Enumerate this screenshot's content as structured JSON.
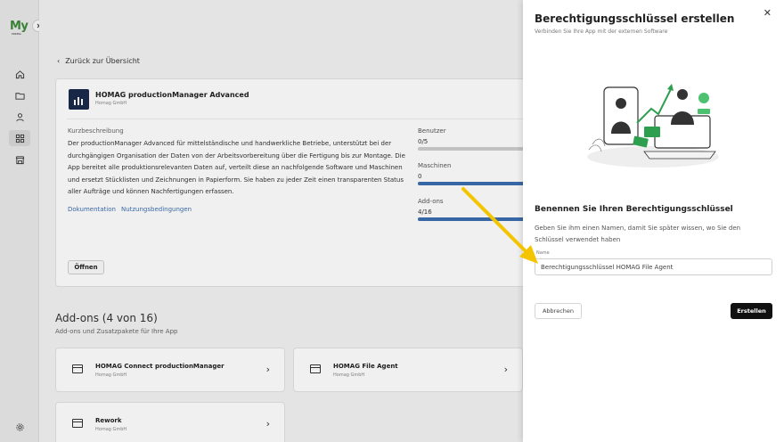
{
  "rail": {
    "logo": "My",
    "logo_sub": "HOMAG"
  },
  "main": {
    "back_link": "Zurück zur Übersicht",
    "app": {
      "title": "HOMAG productionManager Advanced",
      "vendor": "Homag GmbH",
      "description_label": "Kurzbeschreibung",
      "description": "Der productionManager Advanced für mittelständische und handwerkliche Betriebe, unterstützt bei der durchgängigen Organisation der Daten von der Arbeitsvorbereitung über die Fertigung bis zur Montage. Die App bereitet alle produktionsrelevanten Daten auf, verteilt diese an nachfolgende Software und Maschinen und ersetzt Stücklisten und Zeichnungen in Papierform. Sie haben zu jeder Zeit einen transparenten Status aller Aufträge und können Nachfertigungen erfassen.",
      "link_docs": "Dokumentation",
      "link_terms": "Nutzungsbedingungen",
      "open_button": "Öffnen",
      "stats": [
        {
          "label": "Benutzer",
          "value": "0/5",
          "fill": 0
        },
        {
          "label": "Maschinen",
          "value": "0",
          "fill": 1
        },
        {
          "label": "Add-ons",
          "value": "4/16",
          "fill": 1
        }
      ]
    },
    "addons": {
      "title": "Add-ons (4 von 16)",
      "subtitle": "Add-ons und Zusatzpakete für Ihre App",
      "items": [
        {
          "title": "HOMAG Connect productionManager",
          "vendor": "Homag GmbH"
        },
        {
          "title": "HOMAG File Agent",
          "vendor": "Homag GmbH"
        },
        {
          "title": "Rework",
          "vendor": "Homag GmbH"
        }
      ]
    }
  },
  "drawer": {
    "title": "Berechtigungsschlüssel erstellen",
    "subtitle": "Verbinden Sie Ihre App mit der externen Software",
    "heading": "Benennen Sie Ihren Berechtigungsschlüssel",
    "text": "Geben Sie ihm einen Namen, damit Sie später wissen, wo Sie den Schlüssel verwendet haben",
    "field_label": "Name",
    "field_value": "Berechtigungsschlüssel HOMAG File Agent",
    "cancel": "Abbrechen",
    "create": "Erstellen"
  },
  "colors": {
    "accent_green": "#3d8a3a",
    "link_blue": "#3b6fb0",
    "arrow_yellow": "#f5c400"
  }
}
